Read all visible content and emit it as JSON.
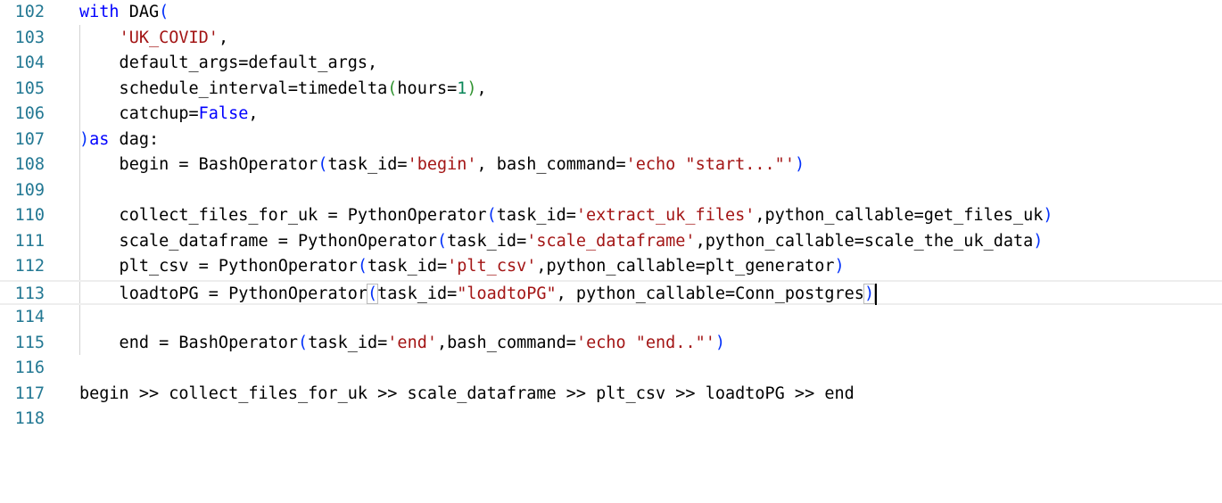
{
  "colors": {
    "line_number": "#237893",
    "keyword": "#0000ff",
    "string": "#a31515",
    "number": "#098658",
    "paren1": "#0431fa",
    "paren2": "#319331",
    "plain": "#000000",
    "indent_guide": "#d3d3d3",
    "current_line_border": "#eeeeee"
  },
  "current_line": 113,
  "lines": [
    {
      "num": "102",
      "tokens": [
        {
          "t": "with",
          "c": "keyword"
        },
        {
          "t": " DAG",
          "c": "plain"
        },
        {
          "t": "(",
          "c": "paren1"
        }
      ]
    },
    {
      "num": "103",
      "tokens": [
        {
          "t": "    ",
          "c": "plain"
        },
        {
          "t": "'UK_COVID'",
          "c": "string"
        },
        {
          "t": ",",
          "c": "plain"
        }
      ]
    },
    {
      "num": "104",
      "tokens": [
        {
          "t": "    default_args=default_args,",
          "c": "plain"
        }
      ]
    },
    {
      "num": "105",
      "tokens": [
        {
          "t": "    schedule_interval=timedelta",
          "c": "plain"
        },
        {
          "t": "(",
          "c": "paren2"
        },
        {
          "t": "hours=",
          "c": "plain"
        },
        {
          "t": "1",
          "c": "number"
        },
        {
          "t": ")",
          "c": "paren2"
        },
        {
          "t": ",",
          "c": "plain"
        }
      ]
    },
    {
      "num": "106",
      "tokens": [
        {
          "t": "    catchup=",
          "c": "plain"
        },
        {
          "t": "False",
          "c": "keyword"
        },
        {
          "t": ",",
          "c": "plain"
        }
      ]
    },
    {
      "num": "107",
      "tokens": [
        {
          "t": ")",
          "c": "paren1"
        },
        {
          "t": "as",
          "c": "keyword"
        },
        {
          "t": " dag:",
          "c": "plain"
        }
      ]
    },
    {
      "num": "108",
      "tokens": [
        {
          "t": "    begin = BashOperator",
          "c": "plain"
        },
        {
          "t": "(",
          "c": "paren1"
        },
        {
          "t": "task_id=",
          "c": "plain"
        },
        {
          "t": "'begin'",
          "c": "string"
        },
        {
          "t": ", bash_command=",
          "c": "plain"
        },
        {
          "t": "'echo \"start...\"'",
          "c": "string"
        },
        {
          "t": ")",
          "c": "paren1"
        }
      ]
    },
    {
      "num": "109",
      "tokens": []
    },
    {
      "num": "110",
      "tokens": [
        {
          "t": "    collect_files_for_uk = PythonOperator",
          "c": "plain"
        },
        {
          "t": "(",
          "c": "paren1"
        },
        {
          "t": "task_id=",
          "c": "plain"
        },
        {
          "t": "'extract_uk_files'",
          "c": "string"
        },
        {
          "t": ",python_callable=get_files_uk",
          "c": "plain"
        },
        {
          "t": ")",
          "c": "paren1"
        }
      ]
    },
    {
      "num": "111",
      "tokens": [
        {
          "t": "    scale_dataframe = PythonOperator",
          "c": "plain"
        },
        {
          "t": "(",
          "c": "paren1"
        },
        {
          "t": "task_id=",
          "c": "plain"
        },
        {
          "t": "'scale_dataframe'",
          "c": "string"
        },
        {
          "t": ",python_callable=scale_the_uk_data",
          "c": "plain"
        },
        {
          "t": ")",
          "c": "paren1"
        }
      ]
    },
    {
      "num": "112",
      "tokens": [
        {
          "t": "    plt_csv = PythonOperator",
          "c": "plain"
        },
        {
          "t": "(",
          "c": "paren1"
        },
        {
          "t": "task_id=",
          "c": "plain"
        },
        {
          "t": "'plt_csv'",
          "c": "string"
        },
        {
          "t": ",python_callable=plt_generator",
          "c": "plain"
        },
        {
          "t": ")",
          "c": "paren1"
        }
      ]
    },
    {
      "num": "113",
      "tokens": [
        {
          "t": "    loadtoPG = PythonOperator",
          "c": "plain"
        },
        {
          "t": "(",
          "c": "paren1",
          "match": true
        },
        {
          "t": "task_id=",
          "c": "plain"
        },
        {
          "t": "\"loadtoPG\"",
          "c": "string"
        },
        {
          "t": ", python_callable=Conn_postgres",
          "c": "plain"
        },
        {
          "t": ")",
          "c": "paren1",
          "match": true
        }
      ]
    },
    {
      "num": "114",
      "tokens": []
    },
    {
      "num": "115",
      "tokens": [
        {
          "t": "    end = BashOperator",
          "c": "plain"
        },
        {
          "t": "(",
          "c": "paren1"
        },
        {
          "t": "task_id=",
          "c": "plain"
        },
        {
          "t": "'end'",
          "c": "string"
        },
        {
          "t": ",bash_command=",
          "c": "plain"
        },
        {
          "t": "'echo \"end..\"'",
          "c": "string"
        },
        {
          "t": ")",
          "c": "paren1"
        }
      ]
    },
    {
      "num": "116",
      "tokens": []
    },
    {
      "num": "117",
      "tokens": [
        {
          "t": "begin >> collect_files_for_uk >> scale_dataframe >> plt_csv >> loadtoPG >> end",
          "c": "plain"
        }
      ]
    },
    {
      "num": "118",
      "tokens": []
    }
  ]
}
